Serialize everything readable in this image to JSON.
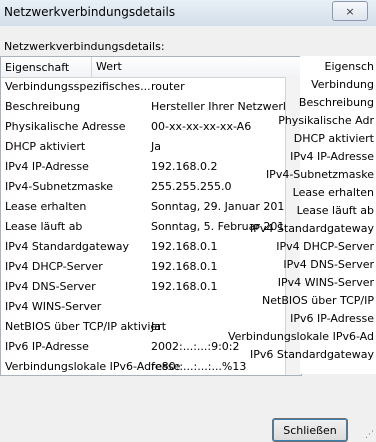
{
  "window": {
    "title": "Netzwerkverbindungsdetails",
    "close_icon": "×"
  },
  "label": "Netzwerkverbindungsdetails:",
  "columns": {
    "property": "Eigenschaft",
    "value": "Wert"
  },
  "rows": [
    {
      "property": "Verbindungsspezifisches...",
      "value": "router"
    },
    {
      "property": "Beschreibung",
      "value": "Hersteller Ihrer Netzwerkkarte"
    },
    {
      "property": "Physikalische Adresse",
      "value": "00-xx-xx-xx-xx-A6"
    },
    {
      "property": "DHCP aktiviert",
      "value": "Ja"
    },
    {
      "property": "IPv4 IP-Adresse",
      "value": "192.168.0.2"
    },
    {
      "property": "IPv4-Subnetzmaske",
      "value": "255.255.255.0"
    },
    {
      "property": "Lease erhalten",
      "value": "Sonntag, 29. Januar 2012 18:19:36"
    },
    {
      "property": "Lease läuft ab",
      "value": "Sonntag, 5. Februar 2012 18:19:36"
    },
    {
      "property": "IPv4 Standardgateway",
      "value": "192.168.0.1"
    },
    {
      "property": "IPv4 DHCP-Server",
      "value": "192.168.0.1"
    },
    {
      "property": "IPv4 DNS-Server",
      "value": "192.168.0.1"
    },
    {
      "property": "IPv4 WINS-Server",
      "value": ""
    },
    {
      "property": "NetBIOS über TCP/IP aktiviert",
      "value": "Ja"
    },
    {
      "property": "IPv6 IP-Adresse",
      "value": "2002:...:...:9:0:2"
    },
    {
      "property": "Verbindungslokale IPv6-Adresse",
      "value": "fe80::...:...:...%13"
    },
    {
      "property": "IPv6 Standardgateway",
      "value": ""
    }
  ],
  "side": [
    "Eigensch",
    "Verbindung",
    "Beschreibung",
    "Physikalische Adr",
    "DHCP aktiviert",
    "IPv4 IP-Adresse",
    "IPv4-Subnetzmaske",
    "Lease erhalten",
    "Lease läuft ab",
    "IPv4 Standardgateway",
    "IPv4 DHCP-Server",
    "IPv4 DNS-Server",
    "IPv4 WINS-Server",
    "NetBIOS über TCP/IP",
    "IPv6 IP-Adresse",
    "Verbindungslokale IPv6-Ad",
    "IPv6 Standardgateway"
  ],
  "side_values": [
    "Sonn",
    "Sonntag",
    "192.168.0.1",
    "192.168.0.1",
    "192.168.0.1"
  ],
  "button": {
    "close_label": "Schließen"
  }
}
